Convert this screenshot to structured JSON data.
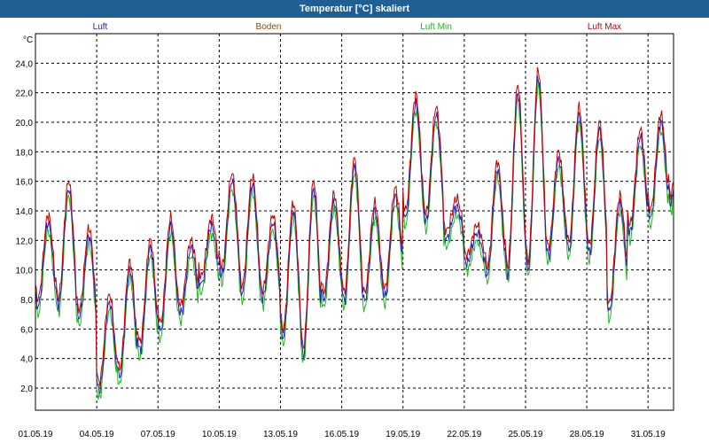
{
  "window": {
    "title": "Temperatur [°C] skaliert"
  },
  "chart_data": {
    "type": "line",
    "title": "Temperatur [°C] skaliert",
    "ylabel": "°C",
    "xlabel": "",
    "ylim": [
      0.5,
      26.0
    ],
    "xlim": [
      0,
      31.25
    ],
    "grid": true,
    "legend_position": "top",
    "y_ticks": [
      "2,0",
      "4,0",
      "6,0",
      "8,0",
      "10,0",
      "12,0",
      "14,0",
      "16,0",
      "18,0",
      "20,0",
      "22,0",
      "24,0"
    ],
    "x_ticks": [
      {
        "label": "01.05.19",
        "day": 0
      },
      {
        "label": "04.05.19",
        "day": 3
      },
      {
        "label": "07.05.19",
        "day": 6
      },
      {
        "label": "10.05.19",
        "day": 9
      },
      {
        "label": "13.05.19",
        "day": 12
      },
      {
        "label": "16.05.19",
        "day": 15
      },
      {
        "label": "19.05.19",
        "day": 18
      },
      {
        "label": "22.05.19",
        "day": 21
      },
      {
        "label": "25.05.19",
        "day": 24
      },
      {
        "label": "28.05.19",
        "day": 27
      },
      {
        "label": "31.05.19",
        "day": 30
      }
    ],
    "series": [
      {
        "name": "Luft",
        "color": "#1f1fbf"
      },
      {
        "name": "Boden",
        "color": "#8b4a00"
      },
      {
        "name": "Luft Min",
        "color": "#1fb81f"
      },
      {
        "name": "Luft Max",
        "color": "#cc0000"
      }
    ],
    "daily_min": [
      7.5,
      7.6,
      7.0,
      1.8,
      2.7,
      4.5,
      5.8,
      7.0,
      9.0,
      9.7,
      8.4,
      8.2,
      5.5,
      4.1,
      8.0,
      7.9,
      7.9,
      8.0,
      13.5,
      13.3,
      12.2,
      10.5,
      9.7,
      9.7,
      10.0,
      11.0,
      11.3,
      11.3,
      7.0,
      12.5,
      13.5,
      14.5
    ],
    "daily_max": [
      13.2,
      15.5,
      12.3,
      7.8,
      10.0,
      11.5,
      13.0,
      11.5,
      13.0,
      16.0,
      15.8,
      13.2,
      14.0,
      15.5,
      14.6,
      17.0,
      14.0,
      15.0,
      21.3,
      20.5,
      14.3,
      12.5,
      16.8,
      22.0,
      23.0,
      17.5,
      20.5,
      19.5,
      14.5,
      19.0,
      20.0,
      23.0
    ]
  }
}
